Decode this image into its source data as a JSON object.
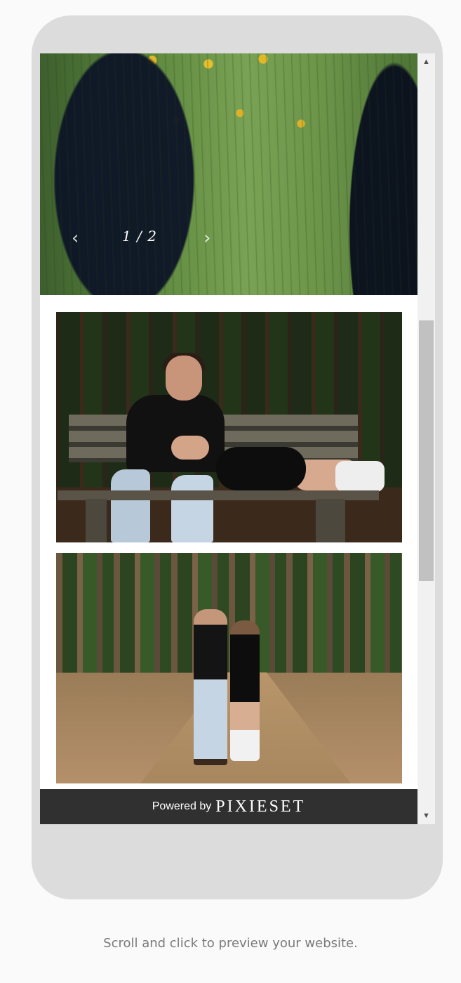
{
  "slideshow": {
    "counter": "1 / 2",
    "prev_icon": "chevron-left-icon",
    "next_icon": "chevron-right-icon",
    "prev_glyph": "‹",
    "next_glyph": "›"
  },
  "gallery": {
    "photos": [
      "couple-on-bench-photo",
      "couple-in-forest-photo"
    ]
  },
  "footer": {
    "powered_by": "Powered by",
    "brand": "PIXIESET"
  },
  "scrollbar": {
    "up_glyph": "▲",
    "down_glyph": "▼"
  },
  "hint": "Scroll and click to preview your website."
}
